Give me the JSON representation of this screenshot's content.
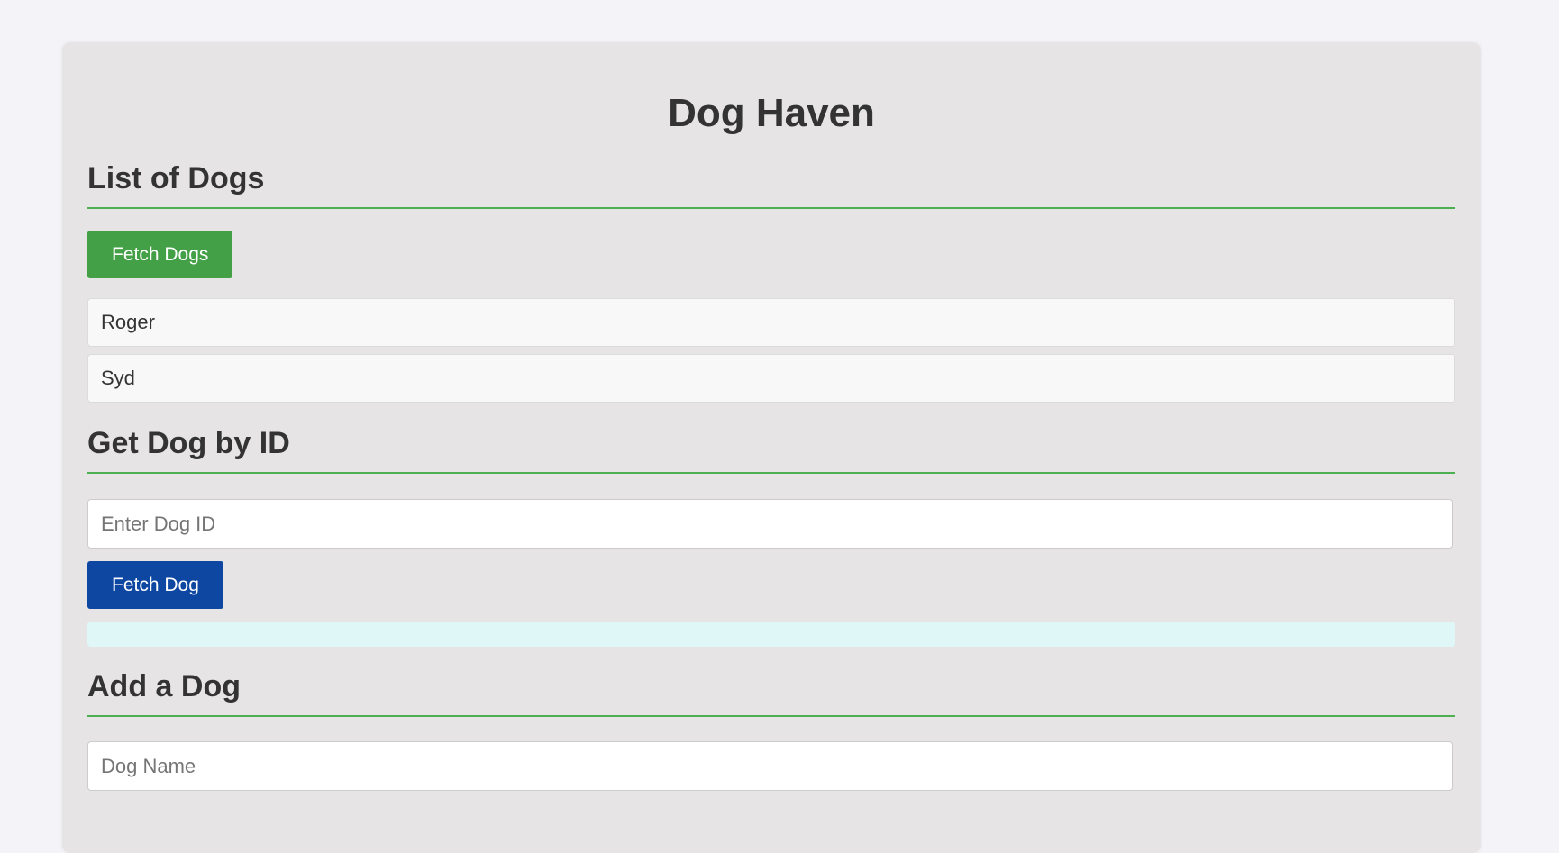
{
  "app": {
    "title": "Dog Haven"
  },
  "list_section": {
    "heading": "List of Dogs",
    "fetch_button": "Fetch Dogs",
    "dogs": [
      "Roger",
      "Syd"
    ]
  },
  "get_section": {
    "heading": "Get Dog by ID",
    "id_placeholder": "Enter Dog ID",
    "id_value": "",
    "fetch_button": "Fetch Dog",
    "result": ""
  },
  "add_section": {
    "heading": "Add a Dog",
    "name_placeholder": "Dog Name",
    "name_value": ""
  },
  "colors": {
    "accent_green": "#43a047",
    "accent_blue": "#0d47a1",
    "divider_green": "#4caf50",
    "result_background": "#e0f7f7"
  }
}
